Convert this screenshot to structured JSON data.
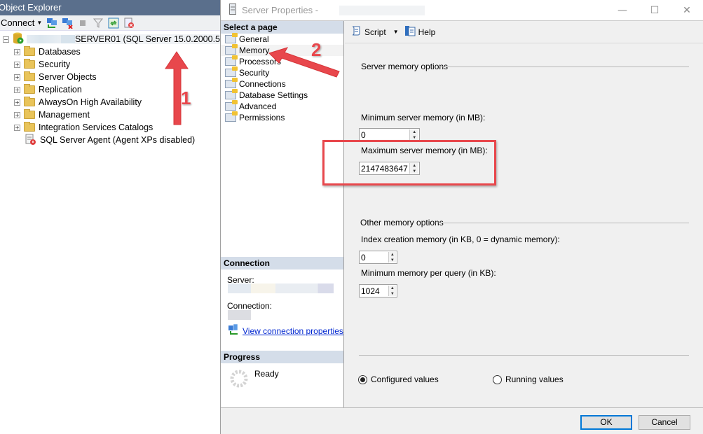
{
  "object_explorer": {
    "title": "Object Explorer",
    "toolbar": {
      "connect_label": "Connect",
      "icons": [
        "connect-object-explorer-icon",
        "disconnect-icon",
        "stop-icon",
        "filter-icon",
        "refresh-icon",
        "activity-monitor-icon"
      ]
    },
    "server_node": {
      "label": "SERVER01 (SQL Server 15.0.2000.5",
      "expander": "−"
    },
    "tree_items": [
      {
        "label": "Databases",
        "expander": "+"
      },
      {
        "label": "Security",
        "expander": "+"
      },
      {
        "label": "Server Objects",
        "expander": "+"
      },
      {
        "label": "Replication",
        "expander": "+"
      },
      {
        "label": "AlwaysOn High Availability",
        "expander": "+"
      },
      {
        "label": "Management",
        "expander": "+"
      },
      {
        "label": "Integration Services Catalogs",
        "expander": "+"
      },
      {
        "label": "SQL Server Agent (Agent XPs disabled)",
        "expander": ""
      }
    ]
  },
  "dialog": {
    "title": "Server Properties -",
    "window_buttons": {
      "minimize": "—",
      "maximize": "☐",
      "close": "✕"
    },
    "select_page": {
      "header": "Select a page",
      "items": [
        "General",
        "Memory",
        "Processors",
        "Security",
        "Connections",
        "Database Settings",
        "Advanced",
        "Permissions"
      ],
      "selected": "Memory"
    },
    "connection": {
      "header": "Connection",
      "server_label": "Server:",
      "connection_label": "Connection:",
      "link": "View connection properties"
    },
    "progress": {
      "header": "Progress",
      "status": "Ready"
    },
    "toolbar": {
      "script_label": "Script",
      "help_label": "Help"
    },
    "memory": {
      "server_memory_group": "Server memory options",
      "min_server_memory_label": "Minimum server memory (in MB):",
      "min_server_memory_value": "0",
      "max_server_memory_label": "Maximum server memory (in MB):",
      "max_server_memory_value": "2147483647",
      "other_memory_group": "Other memory options",
      "index_creation_label": "Index creation memory (in KB, 0 = dynamic memory):",
      "index_creation_value": "0",
      "min_query_memory_label": "Minimum memory per query (in KB):",
      "min_query_memory_value": "1024"
    },
    "value_mode": {
      "options": [
        "Configured values",
        "Running values"
      ],
      "selected": "Configured values"
    },
    "buttons": {
      "ok": "OK",
      "cancel": "Cancel"
    }
  },
  "annotations": {
    "step1": "1",
    "step2": "2",
    "color": "#e8474c"
  }
}
